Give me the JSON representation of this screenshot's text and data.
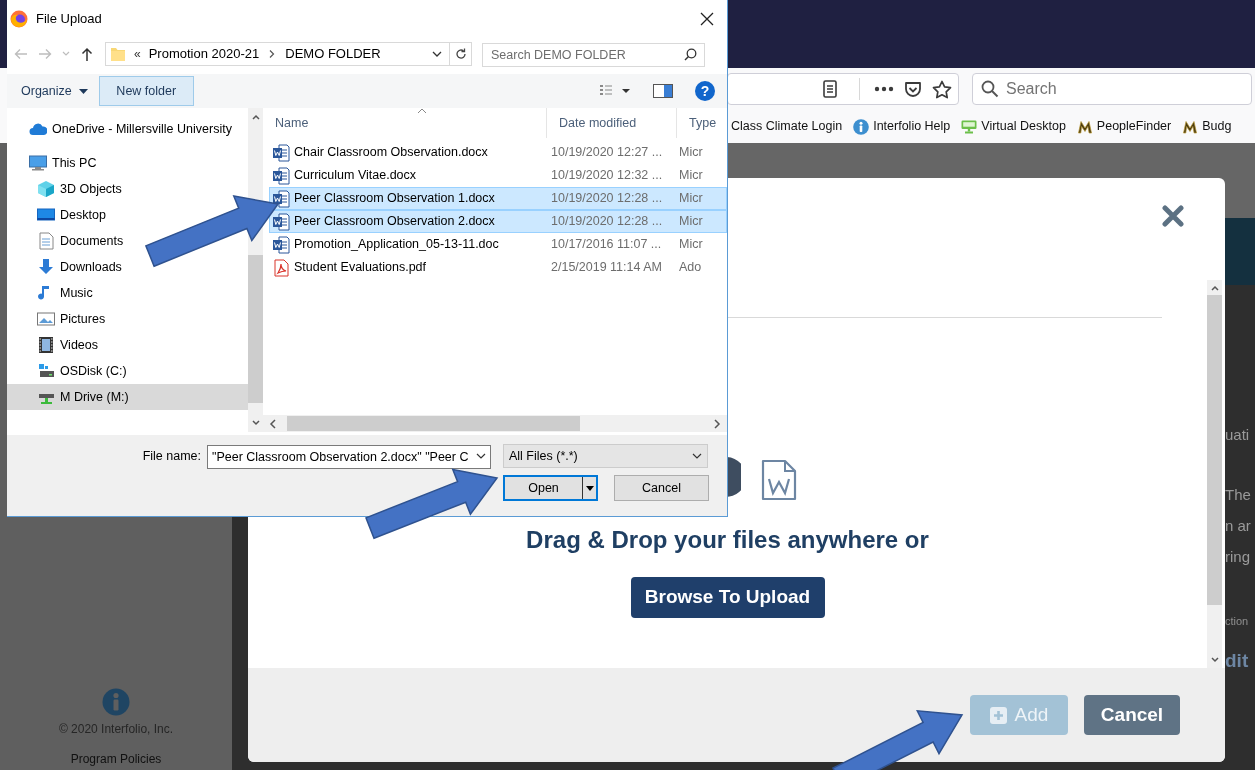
{
  "browser": {
    "search_field": {
      "placeholder": "Search"
    },
    "bookmarks": [
      {
        "label": "Class Climate Login",
        "kind": "plain"
      },
      {
        "label": "Interfolio Help",
        "kind": "info"
      },
      {
        "label": "Virtual Desktop",
        "kind": "monitor"
      },
      {
        "label": "PeopleFinder",
        "kind": "emblem"
      },
      {
        "label": "Budg",
        "kind": "emblem"
      }
    ]
  },
  "page": {
    "copyright": "© 2020 Interfolio, Inc.",
    "footer_link": "Program Policies",
    "fragments": [
      "uati",
      "The",
      "n ar",
      "ring",
      "ction",
      "dit"
    ]
  },
  "upload_modal": {
    "drop_text": "Drag & Drop your files anywhere or",
    "browse_button": "Browse To Upload",
    "add_button": {
      "label": "Add",
      "disabled": true
    },
    "cancel_button": "Cancel"
  },
  "file_dialog": {
    "title": "File Upload",
    "overflow_marker": "«",
    "path": [
      "Promotion 2020-21",
      "DEMO FOLDER"
    ],
    "search_field": {
      "placeholder": "Search DEMO FOLDER"
    },
    "organize": "Organize",
    "new_folder": "New folder",
    "help_glyph": "?",
    "nav_tree": [
      {
        "label": "OneDrive - Millersville University",
        "kind": "cloud",
        "selected": false
      },
      {
        "label": "This PC",
        "kind": "computer",
        "selected": false,
        "children": [
          {
            "label": "3D Objects",
            "kind": "cube",
            "selected": false
          },
          {
            "label": "Desktop",
            "kind": "desktop",
            "selected": false
          },
          {
            "label": "Documents",
            "kind": "documents",
            "selected": false
          },
          {
            "label": "Downloads",
            "kind": "downloads",
            "selected": false
          },
          {
            "label": "Music",
            "kind": "music",
            "selected": false
          },
          {
            "label": "Pictures",
            "kind": "pictures",
            "selected": false
          },
          {
            "label": "Videos",
            "kind": "videos",
            "selected": false
          },
          {
            "label": "OSDisk (C:)",
            "kind": "disk",
            "selected": false
          },
          {
            "label": "M Drive (M:)",
            "kind": "drive",
            "selected": true
          }
        ]
      }
    ],
    "columns": [
      "Name",
      "Date modified",
      "Type"
    ],
    "files": [
      {
        "name": "Chair Classroom Observation.docx",
        "date": "10/19/2020 12:27 ...",
        "type": "Micr",
        "kind": "word",
        "selected": false
      },
      {
        "name": "Curriculum Vitae.docx",
        "date": "10/19/2020 12:32 ...",
        "type": "Micr",
        "kind": "word",
        "selected": false
      },
      {
        "name": "Peer Classroom Observation 1.docx",
        "date": "10/19/2020 12:28 ...",
        "type": "Micr",
        "kind": "word",
        "selected": true
      },
      {
        "name": "Peer Classroom Observation 2.docx",
        "date": "10/19/2020 12:28 ...",
        "type": "Micr",
        "kind": "word",
        "selected": true
      },
      {
        "name": "Promotion_Application_05-13-11.doc",
        "date": "10/17/2016 11:07 ...",
        "type": "Micr",
        "kind": "word",
        "selected": false
      },
      {
        "name": "Student Evaluations.pdf",
        "date": "2/15/2019 11:14 AM",
        "type": "Ado",
        "kind": "pdf",
        "selected": false
      }
    ],
    "file_name_label": "File name:",
    "file_name_value": "\"Peer Classroom Observation 2.docx\" \"Peer C",
    "filter": "All Files (*.*)",
    "open_button": "Open",
    "cancel_button": "Cancel"
  }
}
